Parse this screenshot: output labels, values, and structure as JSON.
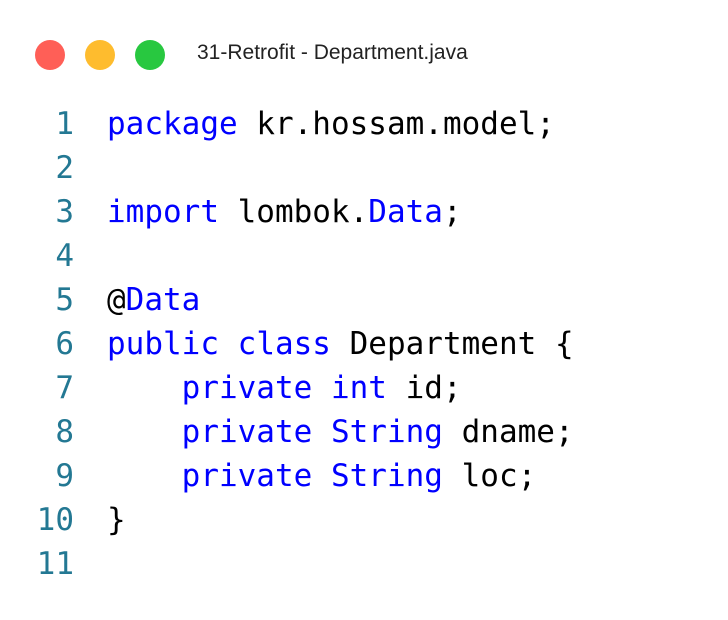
{
  "window": {
    "title": "31-Retrofit - Department.java",
    "buttons": [
      {
        "name": "close",
        "color": "#ff5f57"
      },
      {
        "name": "minimize",
        "color": "#febc2e"
      },
      {
        "name": "maximize",
        "color": "#28c840"
      }
    ]
  },
  "colors": {
    "keyword": "#0000ff",
    "line_number": "#237893",
    "text": "#000000"
  },
  "lines": [
    {
      "n": "1",
      "tokens": [
        {
          "t": "package",
          "k": "kw"
        },
        {
          "t": " kr.hossam.model;",
          "k": "tx"
        }
      ]
    },
    {
      "n": "2",
      "tokens": []
    },
    {
      "n": "3",
      "tokens": [
        {
          "t": "import",
          "k": "kw"
        },
        {
          "t": " lombok.",
          "k": "tx"
        },
        {
          "t": "Data",
          "k": "kw"
        },
        {
          "t": ";",
          "k": "tx"
        }
      ]
    },
    {
      "n": "4",
      "tokens": []
    },
    {
      "n": "5",
      "tokens": [
        {
          "t": "@",
          "k": "tx"
        },
        {
          "t": "Data",
          "k": "kw"
        }
      ]
    },
    {
      "n": "6",
      "tokens": [
        {
          "t": "public",
          "k": "kw"
        },
        {
          "t": " ",
          "k": "tx"
        },
        {
          "t": "class",
          "k": "kw"
        },
        {
          "t": " Department {",
          "k": "tx"
        }
      ]
    },
    {
      "n": "7",
      "tokens": [
        {
          "t": "    ",
          "k": "tx"
        },
        {
          "t": "private",
          "k": "kw"
        },
        {
          "t": " ",
          "k": "tx"
        },
        {
          "t": "int",
          "k": "kw"
        },
        {
          "t": " id;",
          "k": "tx"
        }
      ]
    },
    {
      "n": "8",
      "tokens": [
        {
          "t": "    ",
          "k": "tx"
        },
        {
          "t": "private",
          "k": "kw"
        },
        {
          "t": " ",
          "k": "tx"
        },
        {
          "t": "String",
          "k": "kw"
        },
        {
          "t": " dname;",
          "k": "tx"
        }
      ]
    },
    {
      "n": "9",
      "tokens": [
        {
          "t": "    ",
          "k": "tx"
        },
        {
          "t": "private",
          "k": "kw"
        },
        {
          "t": " ",
          "k": "tx"
        },
        {
          "t": "String",
          "k": "kw"
        },
        {
          "t": " loc;",
          "k": "tx"
        }
      ]
    },
    {
      "n": "10",
      "tokens": [
        {
          "t": "}",
          "k": "tx"
        }
      ]
    },
    {
      "n": "11",
      "tokens": []
    }
  ]
}
